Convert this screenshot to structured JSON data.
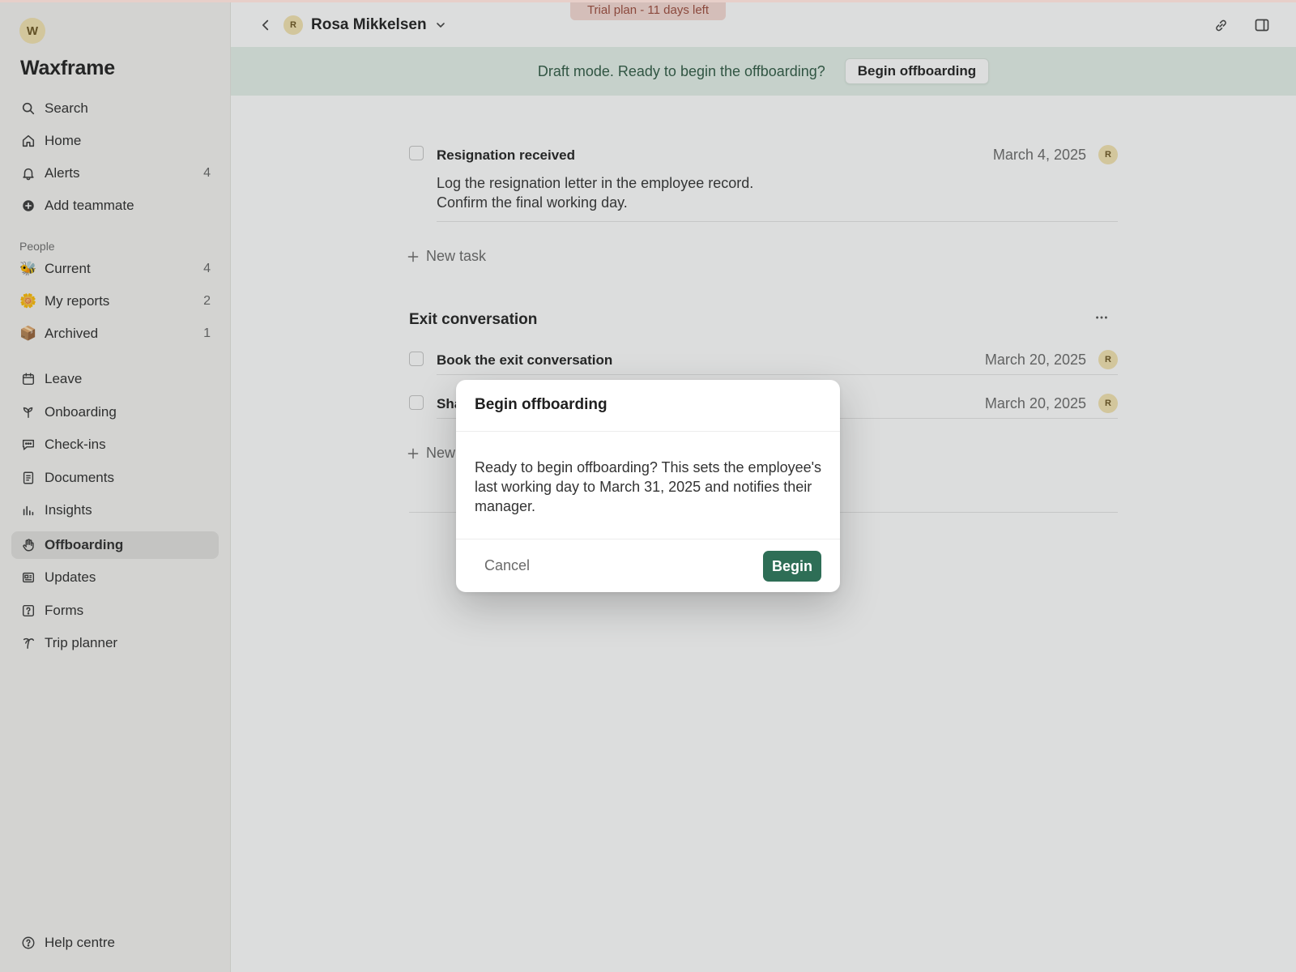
{
  "workspace": {
    "initial": "W",
    "name": "Waxframe"
  },
  "nav_top": [
    {
      "label": "Search",
      "icon": "search-icon",
      "count": ""
    },
    {
      "label": "Home",
      "icon": "home-icon",
      "count": ""
    },
    {
      "label": "Alerts",
      "icon": "bell-icon",
      "count": "4"
    },
    {
      "label": "Add teammate",
      "icon": "plus-circle-icon",
      "count": ""
    }
  ],
  "people_section": {
    "label": "People",
    "items": [
      {
        "label": "Current",
        "emoji": "🐝",
        "count": "4"
      },
      {
        "label": "My reports",
        "emoji": "🌼",
        "count": "2"
      },
      {
        "label": "Archived",
        "emoji": "📦",
        "count": "1"
      }
    ]
  },
  "nav_tools": [
    {
      "label": "Leave",
      "icon": "calendar-icon"
    },
    {
      "label": "Onboarding",
      "icon": "sprout-icon"
    },
    {
      "label": "Check-ins",
      "icon": "chat-icon"
    },
    {
      "label": "Documents",
      "icon": "document-icon"
    },
    {
      "label": "Insights",
      "icon": "bar-chart-icon"
    },
    {
      "label": "Offboarding",
      "icon": "hand-icon",
      "active": true
    },
    {
      "label": "Updates",
      "icon": "newspaper-icon"
    },
    {
      "label": "Forms",
      "icon": "question-square-icon"
    },
    {
      "label": "Trip planner",
      "icon": "palm-tree-icon"
    }
  ],
  "help": {
    "label": "Help centre",
    "icon": "help-circle-icon"
  },
  "trial": {
    "text": "Trial plan - 11 days left"
  },
  "header": {
    "person_initial": "R",
    "person_name": "Rosa Mikkelsen"
  },
  "banner": {
    "text": "Draft mode. Ready to begin the offboarding?",
    "button": "Begin offboarding"
  },
  "tasks_group1": {
    "tasks": [
      {
        "title": "Resignation received",
        "date": "March 4, 2025",
        "assignee": "R",
        "desc_line1": "Log the resignation letter in the employee record.",
        "desc_line2": "Confirm the final working day."
      }
    ],
    "new_task": "New task"
  },
  "tasks_group2": {
    "title": "Exit conversation",
    "tasks": [
      {
        "title": "Book the exit conversation",
        "date": "March 20, 2025",
        "assignee": "R"
      },
      {
        "title": "Sha",
        "date": "March 20, 2025",
        "assignee": "R"
      }
    ],
    "new_task": "New"
  },
  "dialog": {
    "title": "Begin offboarding",
    "body": "Ready to begin offboarding? This sets the employee's last working day to March 31, 2025 and notifies their manager.",
    "cancel": "Cancel",
    "confirm": "Begin"
  }
}
